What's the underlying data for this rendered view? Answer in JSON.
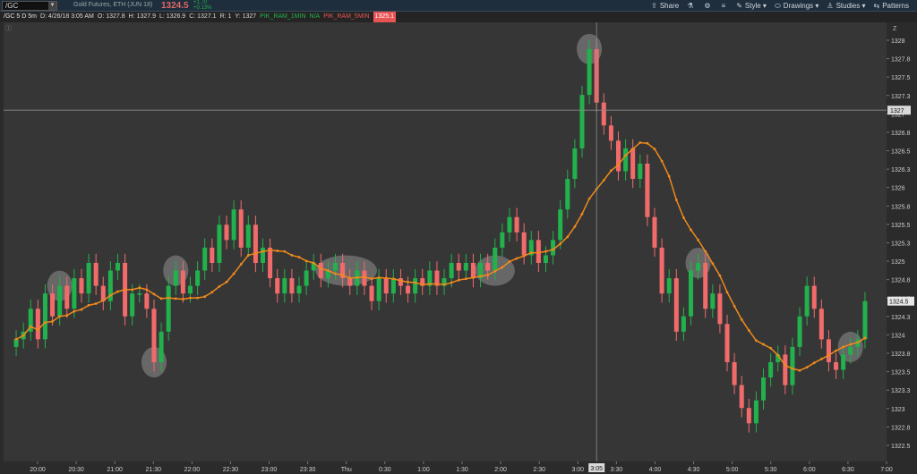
{
  "toolbar": {
    "symbol": "/GC",
    "description": "Gold Futures, ETH (JUN 18)",
    "last_price": "1324.5",
    "change_abs": "+1.70",
    "change_pct": "+0.13%",
    "share": "Share",
    "style": "Style",
    "drawings": "Drawings",
    "studies": "Studies",
    "patterns": "Patterns"
  },
  "infobar": {
    "chart_id": "/GC 5 D 5m",
    "date": "D: 4/26/18 3:05 AM",
    "open": "O: 1327.8",
    "high": "H: 1327.9",
    "low": "L: 1326.9",
    "close": "C: 1327.1",
    "r": "R: 1",
    "y": "Y: 1327",
    "study1_name": "PIK_RAM_1MIN",
    "study1_value": "N/A",
    "study2_name": "PIK_RAM_5MIN",
    "study2_value": "1325.1"
  },
  "colors": {
    "up": "#22b14c",
    "down": "#f26b6b",
    "ma": "#f08a1c",
    "background": "#363636"
  },
  "chart_data": {
    "type": "candlestick",
    "ylim": [
      1322.4,
      1328.15
    ],
    "y_ticks": [
      "1328",
      "1327.8",
      "1327.5",
      "1327.3",
      "1327",
      "1326.8",
      "1326.5",
      "1326.3",
      "1326",
      "1325.8",
      "1325.5",
      "1325.3",
      "1325",
      "1324.8",
      "1324.5",
      "1324.3",
      "1324",
      "1323.8",
      "1323.5",
      "1323.3",
      "1323",
      "1322.8",
      "1322.5"
    ],
    "x_ticks": [
      "20:00",
      "20:30",
      "21:00",
      "21:30",
      "22:00",
      "22:30",
      "23:00",
      "23:30",
      "Thu",
      "0:30",
      "1:00",
      "1:30",
      "2:00",
      "2:30",
      "3:00",
      "3:30",
      "4:00",
      "4:30",
      "5:00",
      "5:30",
      "6:00",
      "6:30",
      "7:00"
    ],
    "crosshair_x_label": "3:05",
    "crosshair_y_label": "1327",
    "current_price_label": "1324.5",
    "closes": [
      1324,
      1324.1,
      1324.4,
      1324.0,
      1324.6,
      1324.3,
      1324.7,
      1324.4,
      1324.8,
      1324.6,
      1325.0,
      1324.7,
      1324.5,
      1324.9,
      1325.0,
      1324.3,
      1324.6,
      1324.6,
      1324.4,
      1323.7,
      1324.1,
      1324.7,
      1324.9,
      1324.6,
      1324.7,
      1324.9,
      1325.2,
      1325.0,
      1325.5,
      1325.3,
      1325.7,
      1325.2,
      1325.5,
      1325.0,
      1325.2,
      1324.8,
      1324.6,
      1324.8,
      1324.6,
      1324.7,
      1324.9,
      1325.0,
      1324.8,
      1324.9,
      1325.0,
      1324.8,
      1324.7,
      1324.9,
      1324.7,
      1324.5,
      1324.8,
      1324.6,
      1324.8,
      1324.7,
      1324.6,
      1324.8,
      1324.7,
      1324.9,
      1324.7,
      1324.8,
      1325.0,
      1324.9,
      1325.0,
      1324.8,
      1325.0,
      1324.9,
      1325.2,
      1325.4,
      1325.6,
      1325.4,
      1325.1,
      1325.3,
      1325.0,
      1325.1,
      1325.3,
      1325.7,
      1326.1,
      1326.5,
      1327.2,
      1327.8,
      1327.1,
      1326.8,
      1326.6,
      1326.2,
      1326.5,
      1326.1,
      1326.3,
      1325.6,
      1325.2,
      1324.6,
      1324.8,
      1324.1,
      1324.3,
      1324.9,
      1325.0,
      1324.4,
      1324.6,
      1324.2,
      1323.7,
      1323.4,
      1323.1,
      1322.9,
      1323.2,
      1323.5,
      1323.7,
      1323.8,
      1323.4,
      1323.9,
      1324.3,
      1324.7,
      1324.4,
      1324.0,
      1323.7,
      1323.6,
      1323.8,
      1323.9,
      1324.0,
      1324.5
    ]
  }
}
